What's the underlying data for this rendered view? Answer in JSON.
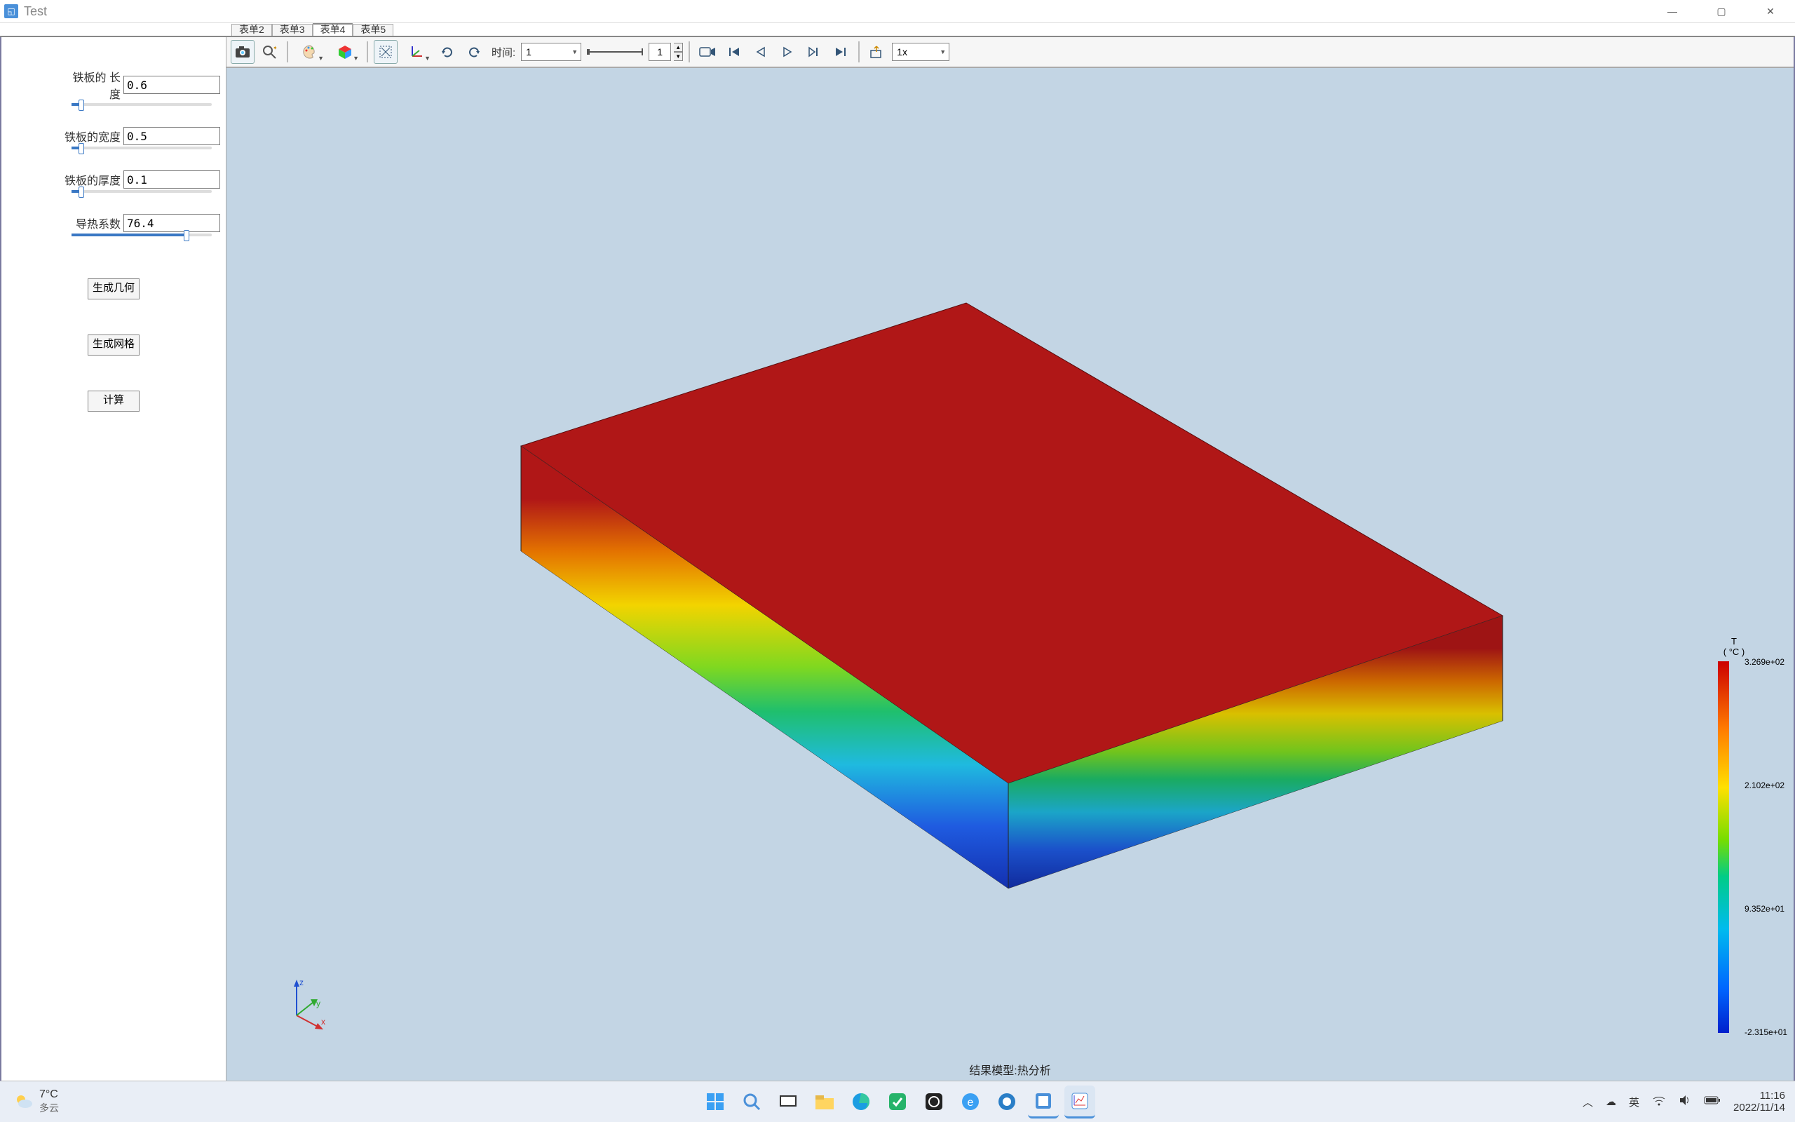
{
  "window": {
    "title": "Test",
    "min": "—",
    "max": "▢",
    "close": "✕"
  },
  "tabs": [
    "表单2",
    "表单3",
    "表单4",
    "表单5"
  ],
  "active_tab": 2,
  "params": {
    "items": [
      {
        "label": "铁板的 长度",
        "value": "0.6",
        "fill": 0.05
      },
      {
        "label": "铁板的宽度",
        "value": "0.5",
        "fill": 0.05
      },
      {
        "label": "铁板的厚度",
        "value": "0.1",
        "fill": 0.05
      },
      {
        "label": "导热系数",
        "value": "76.4",
        "fill": 0.8
      }
    ]
  },
  "side_buttons": [
    "生成几何",
    "生成网格",
    "计算"
  ],
  "toolbar": {
    "time_label": "时间:",
    "time_value": "1",
    "frame_value": "1",
    "speed": "1x"
  },
  "legend": {
    "title1": "T",
    "title2": "( °C )",
    "ticks": [
      {
        "pos": 0,
        "label": "3.269e+02"
      },
      {
        "pos": 176,
        "label": "2.102e+02"
      },
      {
        "pos": 352,
        "label": "9.352e+01"
      },
      {
        "pos": 528,
        "label": "-2.315e+01"
      }
    ]
  },
  "caption": "结果模型:热分析",
  "axes": {
    "x": "x",
    "y": "y",
    "z": "z"
  },
  "taskbar": {
    "temp": "7°C",
    "weather": "多云",
    "ime": "英",
    "time": "11:16",
    "date": "2022/11/14"
  }
}
